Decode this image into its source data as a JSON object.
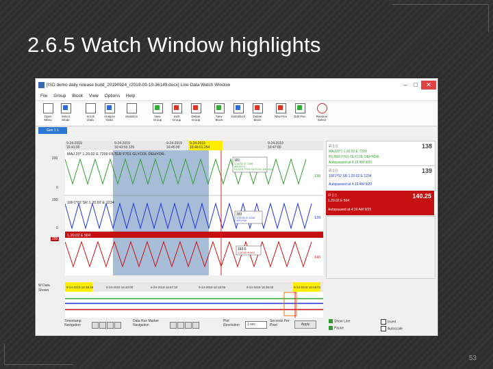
{
  "slide": {
    "title": "2.6.5  Watch Window highlights",
    "page_number": "53"
  },
  "window": {
    "title": "[ISD demo daily release build_20190924_r2019-09-10-36149.docx] Line Data Watch Window",
    "controls": {
      "minimize": "–",
      "maximize": "□",
      "close": "✕"
    },
    "menu": [
      "File",
      "Group",
      "Block",
      "View",
      "Options",
      "Help"
    ]
  },
  "toolbar": [
    {
      "label": "Open Menu",
      "icon": "open-menu-icon"
    },
    {
      "label": "Select Mode",
      "icon": "select-mode-icon"
    },
    {
      "label": "Scroll Data",
      "icon": "scroll-data-icon"
    },
    {
      "label": "Analyze Data",
      "icon": "analyze-data-icon"
    },
    {
      "label": "Statistics",
      "icon": "statistics-icon"
    },
    {
      "label": "New Group",
      "icon": "new-group-icon"
    },
    {
      "label": "Edit Group",
      "icon": "edit-group-icon"
    },
    {
      "label": "Delete Group",
      "icon": "delete-group-icon"
    },
    {
      "label": "New Block",
      "icon": "new-block-icon"
    },
    {
      "label": "Edit Block",
      "icon": "edit-block-icon"
    },
    {
      "label": "Delete Block",
      "icon": "delete-block-icon"
    },
    {
      "label": "New Pen",
      "icon": "new-pen-icon"
    },
    {
      "label": "Edit Pen",
      "icon": "edit-pen-icon"
    },
    {
      "label": "Reverse Select",
      "icon": "reverse-select-icon"
    }
  ],
  "tab": {
    "label": "Gen 1 1"
  },
  "plot_header": {
    "left_time": [
      "9-24-2019",
      "16:41:00"
    ],
    "cursor_time": [
      "9-24-2019",
      "16:43:50.125"
    ],
    "mid_time": [
      "9-24-2019",
      "16:45:00"
    ],
    "highlight_time": [
      "9-24-2019",
      "16:46:01.254"
    ],
    "right_time": [
      "9-24-2019",
      "16:47:00"
    ]
  },
  "plot": {
    "y_labels": {
      "top_max": "200",
      "top_min": "0",
      "mid_max": "200",
      "mid_min": "0",
      "bot_max": "200"
    },
    "trace_labels": {
      "green": "MAJ 20* 1.20.02 E 7299      FILTER F701  GLYCOL DEHYDR.",
      "blue": "10F1*02 SR 1.20.02 E 1234",
      "red": "1.20.02 E 504"
    },
    "end_values": {
      "green": "138",
      "blue": "139",
      "red": "140"
    },
    "popups": {
      "green": [
        "181",
        "1.20.02 E 7299",
        "MAJ20*1",
        "FILTER F701  GLYCOL DEHYD"
      ],
      "blue": [
        "183",
        "1.20.02 E 1234",
        "10F1*02"
      ],
      "red": [
        "183.5",
        "1.20.02 E 504"
      ]
    }
  },
  "right_panel": [
    {
      "value": "138",
      "lines": [
        "MAJ20*1 1.20.02 E 7299",
        "FILTER F701   GLYCOL DEHYDR",
        "Autopaused at 4:19 AM 9/20"
      ]
    },
    {
      "value": "139",
      "lines": [
        "10F1*02 SR 1.20.02 E 1234",
        "Autopaused at 4:19 AM 9/20"
      ]
    },
    {
      "value": "140.25",
      "lines": [
        "1.20.02 E 504",
        "Autopaused at 4:19 AM 9/25"
      ]
    }
  ],
  "overview": {
    "side_label": [
      "W Data",
      "Shown"
    ],
    "times": [
      "9-24-2019 16:39:49",
      "9-24-2019 16:40:00",
      "9-24-2019 16:57:00",
      "9-24-2019 16:16:00",
      "9-24-2019 16:36:00",
      "9-24-2019 16:46:01"
    ]
  },
  "bottombar": {
    "timestamp_nav": "Timestamp Navigation",
    "data_marker_nav": "Data Run Marker Navigation",
    "plot_resolution": "Plot Resolution",
    "resolution_value": "1 sec",
    "seconds_per_pixel": "Seconds Per Pixel",
    "apply": "Apply",
    "show_line": "Show Line",
    "pause": "Pause",
    "invert": "Invert",
    "autoscale": "Autoscale"
  },
  "colors": {
    "green_trace": "#2ea02e",
    "blue_trace": "#1a35d6",
    "red_trace": "#cc1010",
    "highlight_band": "#8aa6c9",
    "marker_yellow": "#ffee00",
    "tab_blue": "#2b78d6"
  }
}
